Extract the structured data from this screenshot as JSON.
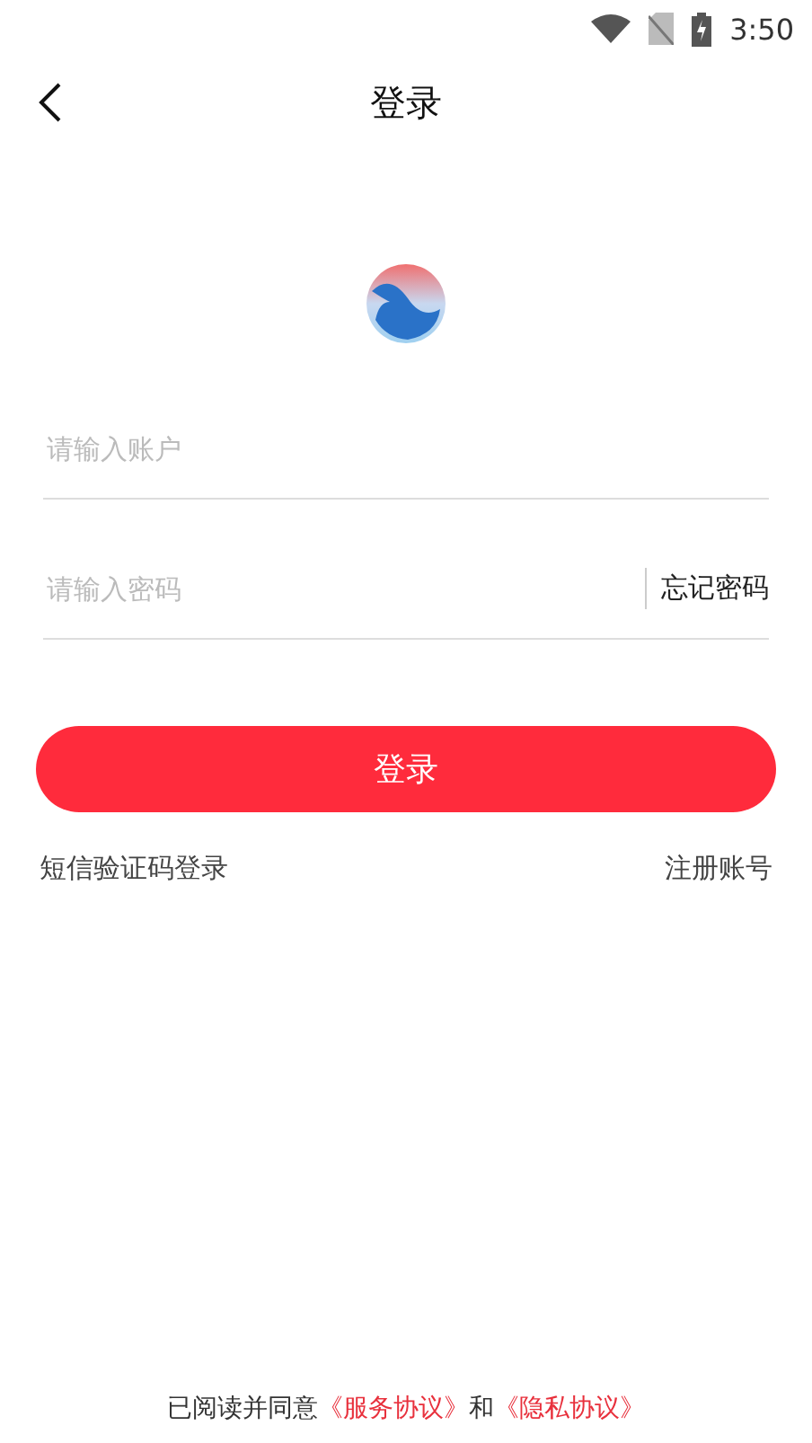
{
  "status_bar": {
    "time": "3:50"
  },
  "header": {
    "title": "登录"
  },
  "account_field": {
    "placeholder": "请输入账户"
  },
  "password_field": {
    "placeholder": "请输入密码",
    "forgot": "忘记密码"
  },
  "login_button": "登录",
  "links": [
    "短信验证码登录",
    "注册账号"
  ],
  "agreement": {
    "text": "已阅读并同意",
    "link1": "《服务协议》",
    "and": "和",
    "link2": "《隐私协议》"
  }
}
